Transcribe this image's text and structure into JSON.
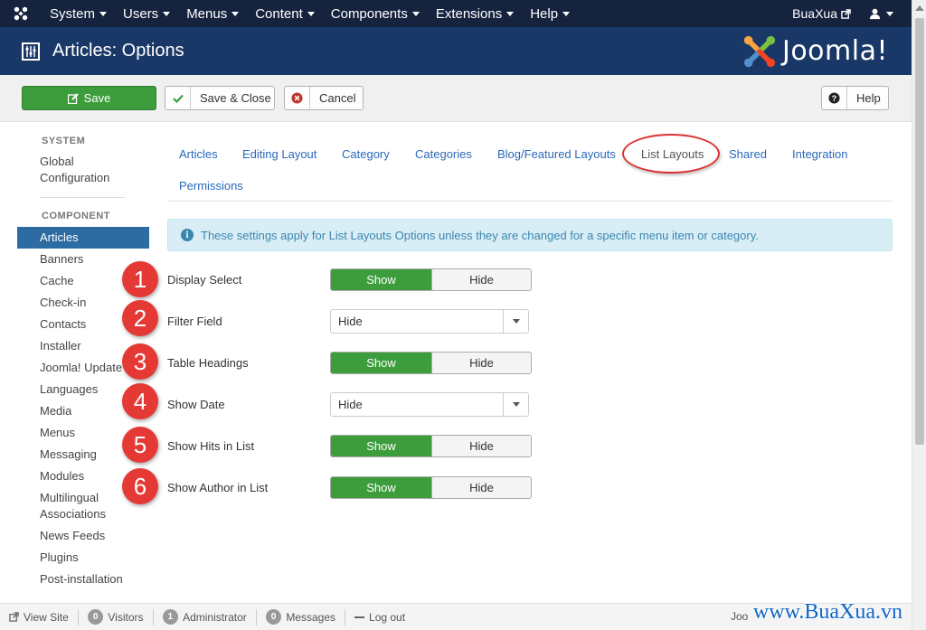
{
  "topbar": {
    "menu": [
      "System",
      "Users",
      "Menus",
      "Content",
      "Components",
      "Extensions",
      "Help"
    ],
    "site_name": "BuaXua"
  },
  "header": {
    "title": "Articles: Options",
    "brand": "Joomla!",
    "brand_colors": [
      "#f9a541",
      "#7ac143",
      "#f44321",
      "#5091cd"
    ]
  },
  "toolbar": {
    "save": "Save",
    "save_close": "Save & Close",
    "cancel": "Cancel",
    "help": "Help"
  },
  "sidebar": {
    "system_heading": "SYSTEM",
    "global_config": [
      "Global",
      "Configuration"
    ],
    "component_heading": "COMPONENT",
    "items": [
      "Articles",
      "Banners",
      "Cache",
      "Check-in",
      "Contacts",
      "Installer",
      "Joomla! Update",
      "Languages",
      "Media",
      "Menus",
      "Messaging",
      "Modules"
    ],
    "multilingual": [
      "Multilingual",
      "Associations"
    ],
    "more": [
      "News Feeds",
      "Plugins",
      "Post-installation"
    ],
    "active": "Articles"
  },
  "tabs": [
    "Articles",
    "Editing Layout",
    "Category",
    "Categories",
    "Blog/Featured Layouts",
    "List Layouts",
    "Shared",
    "Integration",
    "Permissions"
  ],
  "active_tab": "List Layouts",
  "alert": "These settings apply for List Layouts Options unless they are changed for a specific menu item or category.",
  "fields": [
    {
      "num": "1",
      "label": "Display Select",
      "type": "toggle",
      "on": "Show",
      "off": "Hide"
    },
    {
      "num": "2",
      "label": "Filter Field",
      "type": "select",
      "value": "Hide"
    },
    {
      "num": "3",
      "label": "Table Headings",
      "type": "toggle",
      "on": "Show",
      "off": "Hide"
    },
    {
      "num": "4",
      "label": "Show Date",
      "type": "select",
      "value": "Hide"
    },
    {
      "num": "5",
      "label": "Show Hits in List",
      "type": "toggle",
      "on": "Show",
      "off": "Hide"
    },
    {
      "num": "6",
      "label": "Show Author in List",
      "type": "toggle",
      "on": "Show",
      "off": "Hide"
    }
  ],
  "statusbar": {
    "view_site": "View Site",
    "visitors_count": "0",
    "visitors": "Visitors",
    "admin_count": "1",
    "administrator": "Administrator",
    "messages_count": "0",
    "messages": "Messages",
    "logout": "Log out",
    "joo": "Joo"
  },
  "watermark": "www.BuaXua.vn",
  "colors": {
    "topbar": "#16233f",
    "header": "#1a3867",
    "save_green": "#3d9d3d",
    "link_blue": "#2a69b8",
    "active_sidebar": "#2d6ca2",
    "badge_red": "#e53935"
  }
}
